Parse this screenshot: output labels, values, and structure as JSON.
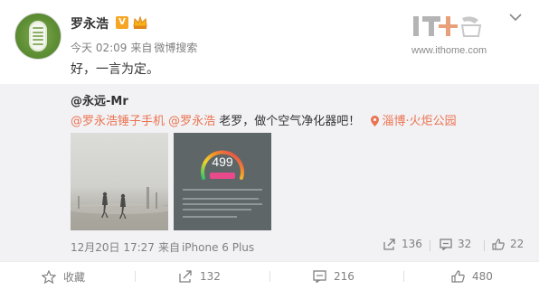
{
  "post": {
    "author": "罗永浩",
    "verified_mark": "V",
    "time": "今天 02:09",
    "from": "来自",
    "source": "微博搜索",
    "content": "好，一言为定。"
  },
  "watermark": {
    "url": "www.ithome.com"
  },
  "repost": {
    "user": "@永远-Mr",
    "mention1": "@罗永浩锤子手机",
    "mention2": "@罗永浩",
    "text": " 老罗，做个空气净化器吧！",
    "location": "淄博·火炬公园",
    "gauge_value": "499",
    "time": "12月20日 17:27",
    "from": "来自",
    "source": "iPhone 6 Plus",
    "actions": {
      "forward": "136",
      "comment": "32",
      "like": "22"
    }
  },
  "bottom": {
    "favorite": "收藏",
    "forward": "132",
    "comment": "216",
    "like": "480"
  },
  "colors": {
    "link": "#eb7350",
    "muted": "#808080",
    "repost_bg": "#f2f2f5"
  }
}
